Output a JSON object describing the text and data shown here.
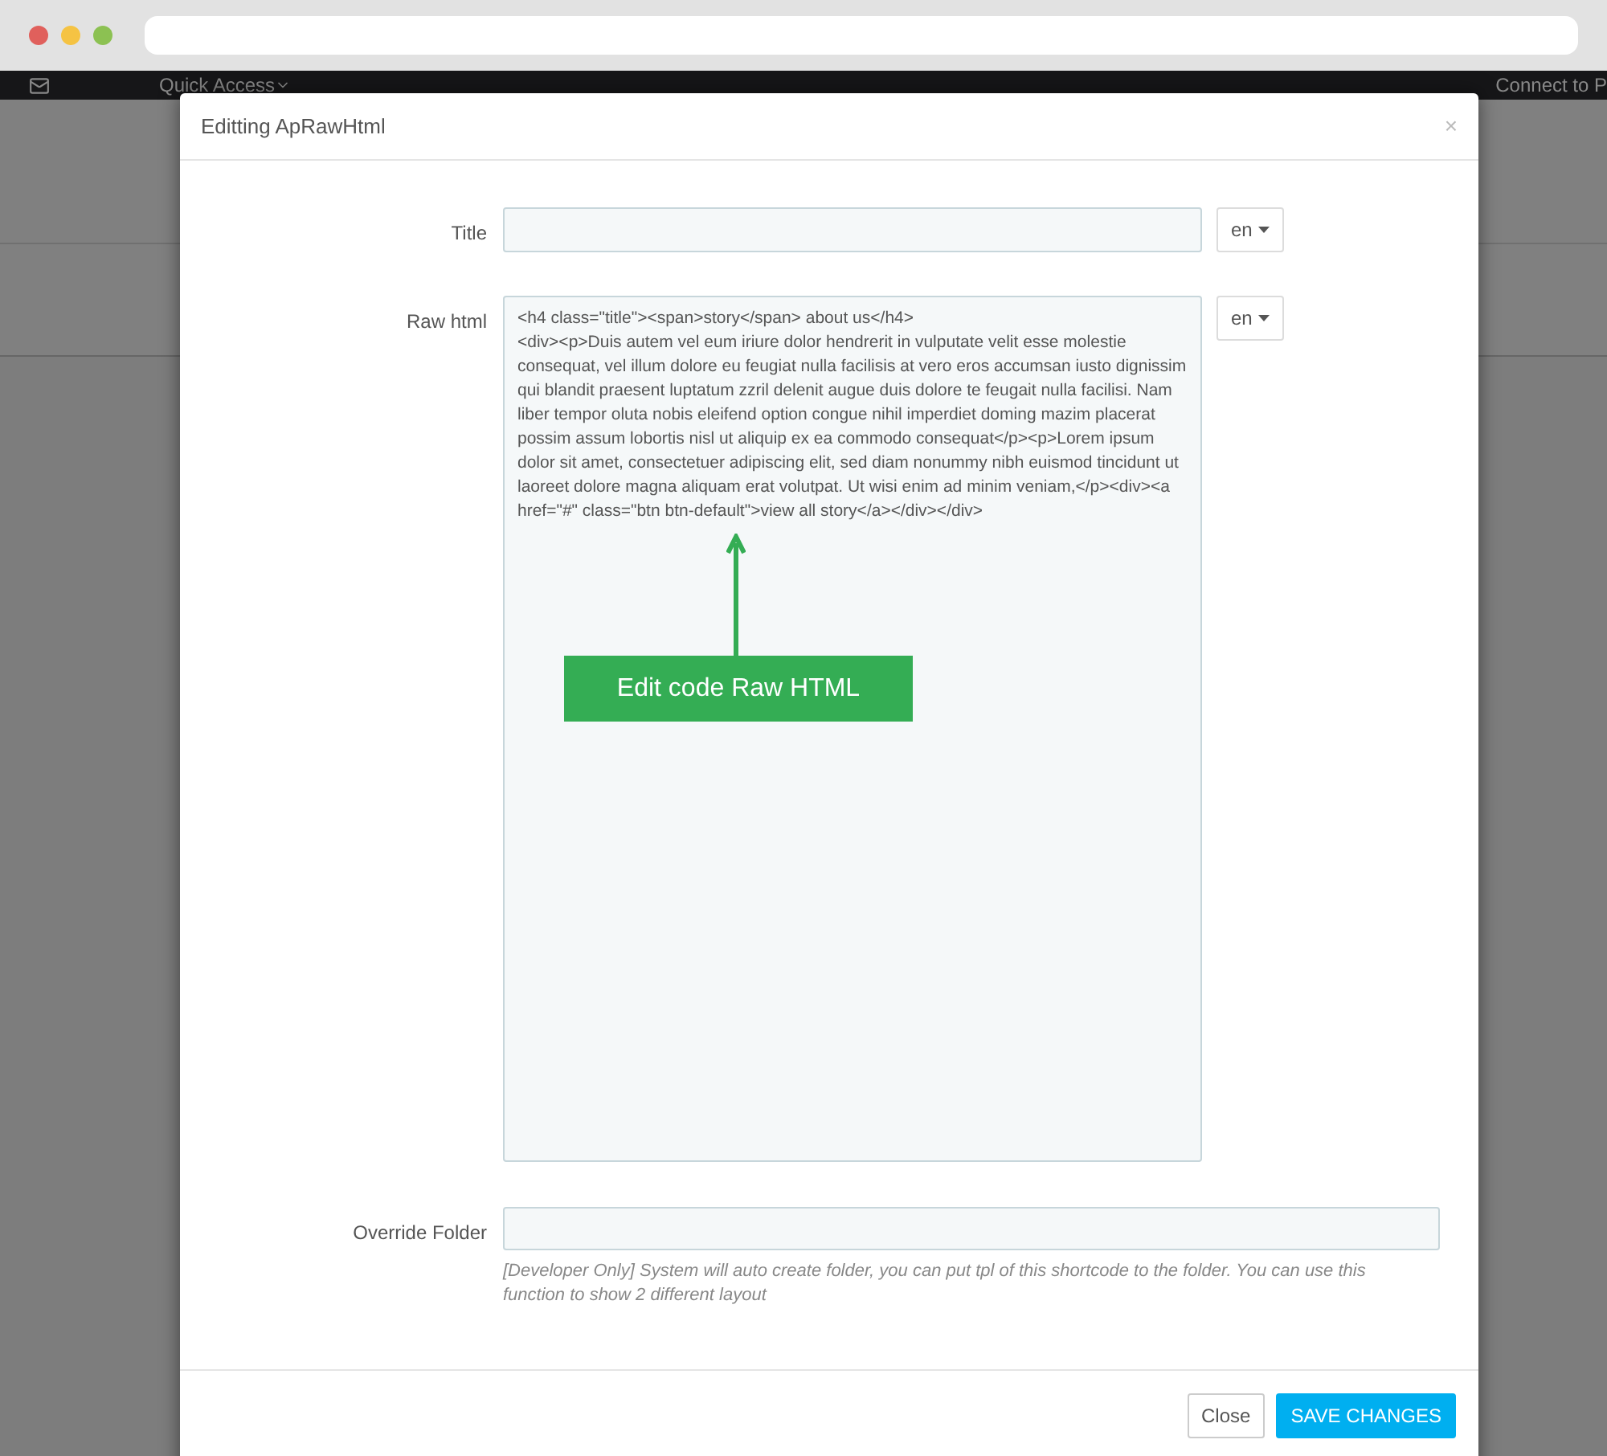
{
  "admin_bar": {
    "menu": "Quick Access",
    "connect": "Connect to P"
  },
  "modal": {
    "title": "Editting ApRawHtml",
    "close": "×",
    "fields": [
      {
        "kind": "input",
        "label": "Title",
        "lang": "en"
      },
      {
        "kind": "textarea",
        "label": "Raw html",
        "lang": "en",
        "value": "<h4 class=\"title\"><span>story</span> about us</h4>\n<div><p>Duis autem vel eum iriure dolor hendrerit in vulputate velit esse molestie consequat, vel illum dolore eu feugiat nulla facilisis at vero eros accumsan iusto dignissim qui blandit praesent luptatum zzril delenit augue duis dolore te feugait nulla facilisi. Nam liber tempor oluta nobis eleifend option congue nihil imperdiet doming mazim placerat possim assum lobortis nisl ut aliquip ex ea commodo consequat</p><p>Lorem ipsum dolor sit amet, consectetuer adipiscing elit, sed diam nonummy nibh euismod tincidunt ut laoreet dolore magna aliquam erat volutpat. Ut wisi enim ad minim veniam,</p><div><a href=\"#\" class=\"btn btn-default\">view all story</a></div></div>",
        "annotation": "Edit code Raw HTML"
      },
      {
        "kind": "wide",
        "label": "Override Folder",
        "help": "[Developer Only] System will auto create folder, you can put tpl of this shortcode to the folder. You can use this function to show 2 different layout"
      }
    ],
    "buttons": [
      {
        "label": "Close",
        "kind": "default"
      },
      {
        "label": "SAVE CHANGES",
        "kind": "primary"
      }
    ]
  }
}
